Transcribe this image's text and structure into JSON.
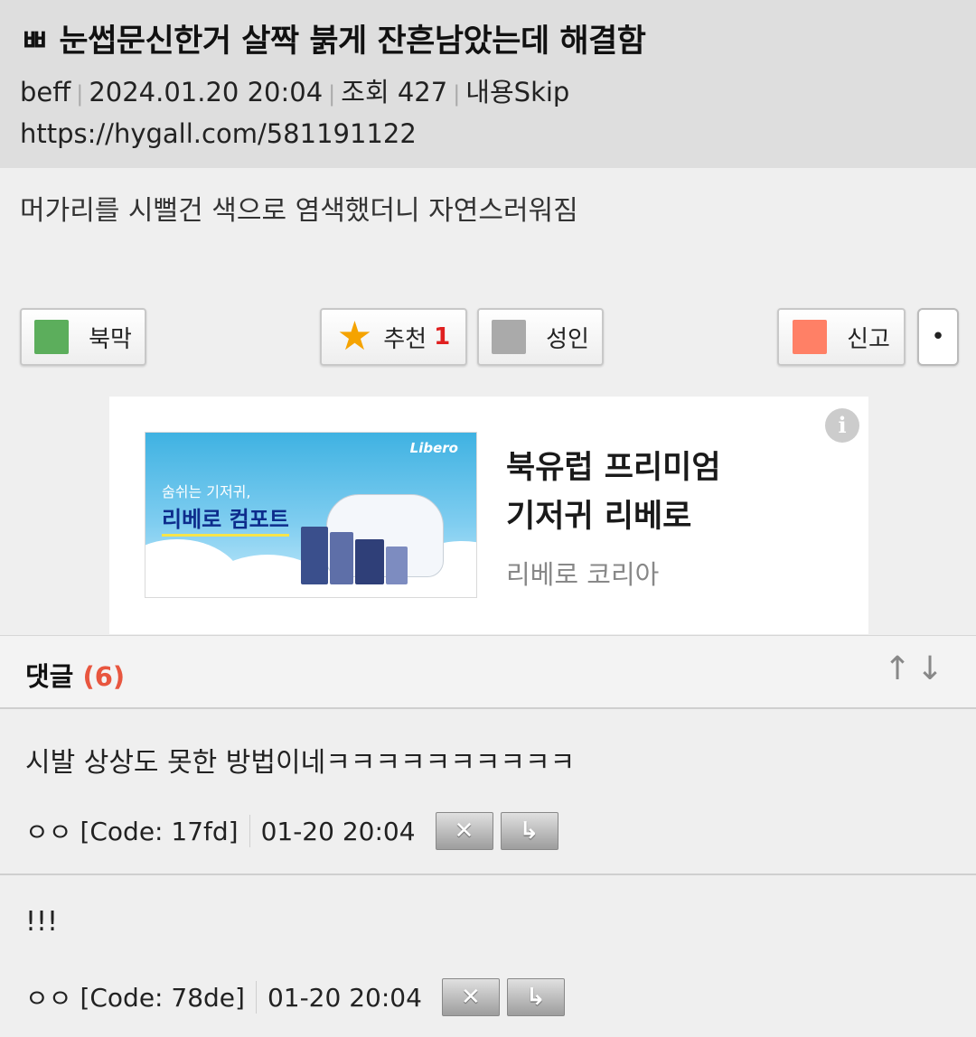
{
  "post": {
    "title": "ㅃ 눈썹문신한거 살짝 붉게 잔흔남았는데 해결함",
    "author": "beff",
    "date": "2024.01.20 20:04",
    "views": "조회 427",
    "skip": "내용Skip",
    "url": "https://hygall.com/581191122",
    "body": "머가리를 시뻘건 색으로 염색했더니 자연스러워짐"
  },
  "buttons": {
    "bookmark": "북막",
    "recommend": "추천",
    "recommend_count": "1",
    "adult": "성인",
    "report": "신고",
    "more": "•"
  },
  "colors": {
    "bookmark_square": "#5cae5c",
    "adult_square": "#aaaaaa",
    "report_square": "#ff8066",
    "recommend_count": "#e02020",
    "comment_count": "#e8563f"
  },
  "ad": {
    "image_small_text": "숨쉬는 기저귀,",
    "image_big_text": "리베로 컴포트",
    "image_logo": "Libero",
    "title": "북유럽 프리미엄 기저귀 리베로",
    "advertiser": "리베로 코리아",
    "info_icon": "i"
  },
  "comments_header": {
    "label": "댓글",
    "count": "(6)",
    "up": "↑",
    "down": "↓"
  },
  "comments": [
    {
      "text": "시발 상상도 못한 방법이네ㅋㅋㅋㅋㅋㅋㅋㅋㅋㅋ",
      "author": "ㅇㅇ",
      "code": "[Code: 17fd]",
      "time": "01-20 20:04",
      "delete": "✕",
      "reply": "↳"
    },
    {
      "text": "!!!",
      "author": "ㅇㅇ",
      "code": "[Code: 78de]",
      "time": "01-20 20:04",
      "delete": "✕",
      "reply": "↳"
    }
  ]
}
